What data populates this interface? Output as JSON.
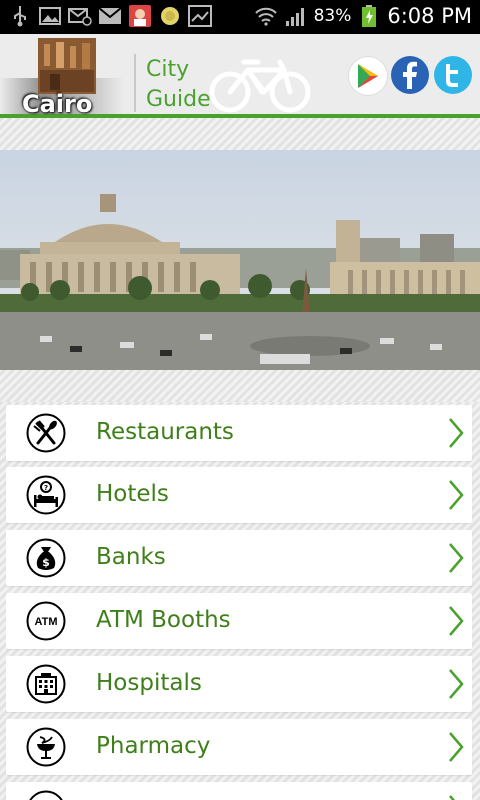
{
  "status_bar": {
    "battery": "83%",
    "time": "6:08 PM",
    "icons": [
      "usb-icon",
      "image-icon",
      "mail-at-icon",
      "mail-icon",
      "app-icon",
      "coin-icon",
      "trend-icon",
      "wifi-icon",
      "signal-icon",
      "battery-icon"
    ]
  },
  "header": {
    "logo_text": "Cairo",
    "title_line1": "City",
    "title_line2": "Guide",
    "social": [
      "google-play-icon",
      "facebook-icon",
      "twitter-icon"
    ],
    "accent_color": "#4aa22e"
  },
  "menu": [
    {
      "label": "Restaurants",
      "icon": "restaurant-icon"
    },
    {
      "label": "Hotels",
      "icon": "hotel-icon"
    },
    {
      "label": "Banks",
      "icon": "bank-icon"
    },
    {
      "label": "ATM Booths",
      "icon": "atm-icon",
      "icon_text": "ATM"
    },
    {
      "label": "Hospitals",
      "icon": "hospital-icon"
    },
    {
      "label": "Pharmacy",
      "icon": "pharmacy-icon"
    },
    {
      "label": "",
      "icon": "partial-icon"
    }
  ]
}
